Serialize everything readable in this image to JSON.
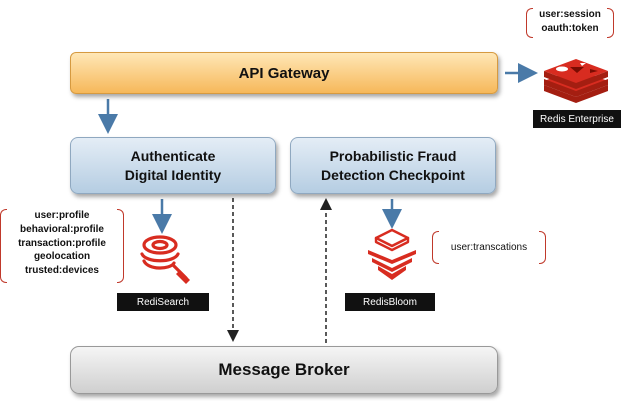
{
  "nodes": {
    "gateway": "API Gateway",
    "authenticate": [
      "Authenticate",
      "Digital Identity"
    ],
    "fraud": [
      "Probabilistic Fraud",
      "Detection Checkpoint"
    ],
    "broker": "Message Broker"
  },
  "stores": {
    "redis_enterprise": {
      "label": "Redis Enterprise",
      "keys": [
        "user:session",
        "oauth:token"
      ]
    },
    "redisearch": {
      "label": "RediSearch",
      "keys": [
        "user:profile",
        "behavioral:profile",
        "transaction:profile",
        "geolocation",
        "trusted:devices"
      ]
    },
    "redisbloom": {
      "label": "RedisBloom",
      "keys": [
        "user:transcations"
      ]
    }
  },
  "colors": {
    "redis_red": "#d82c20",
    "arrow_blue": "#4a7aa8",
    "gateway_orange": "#f6b85a",
    "box_blue": "#b5cde2"
  },
  "icons": [
    "redis-logo-icon",
    "redisearch-icon",
    "redisbloom-icon"
  ]
}
